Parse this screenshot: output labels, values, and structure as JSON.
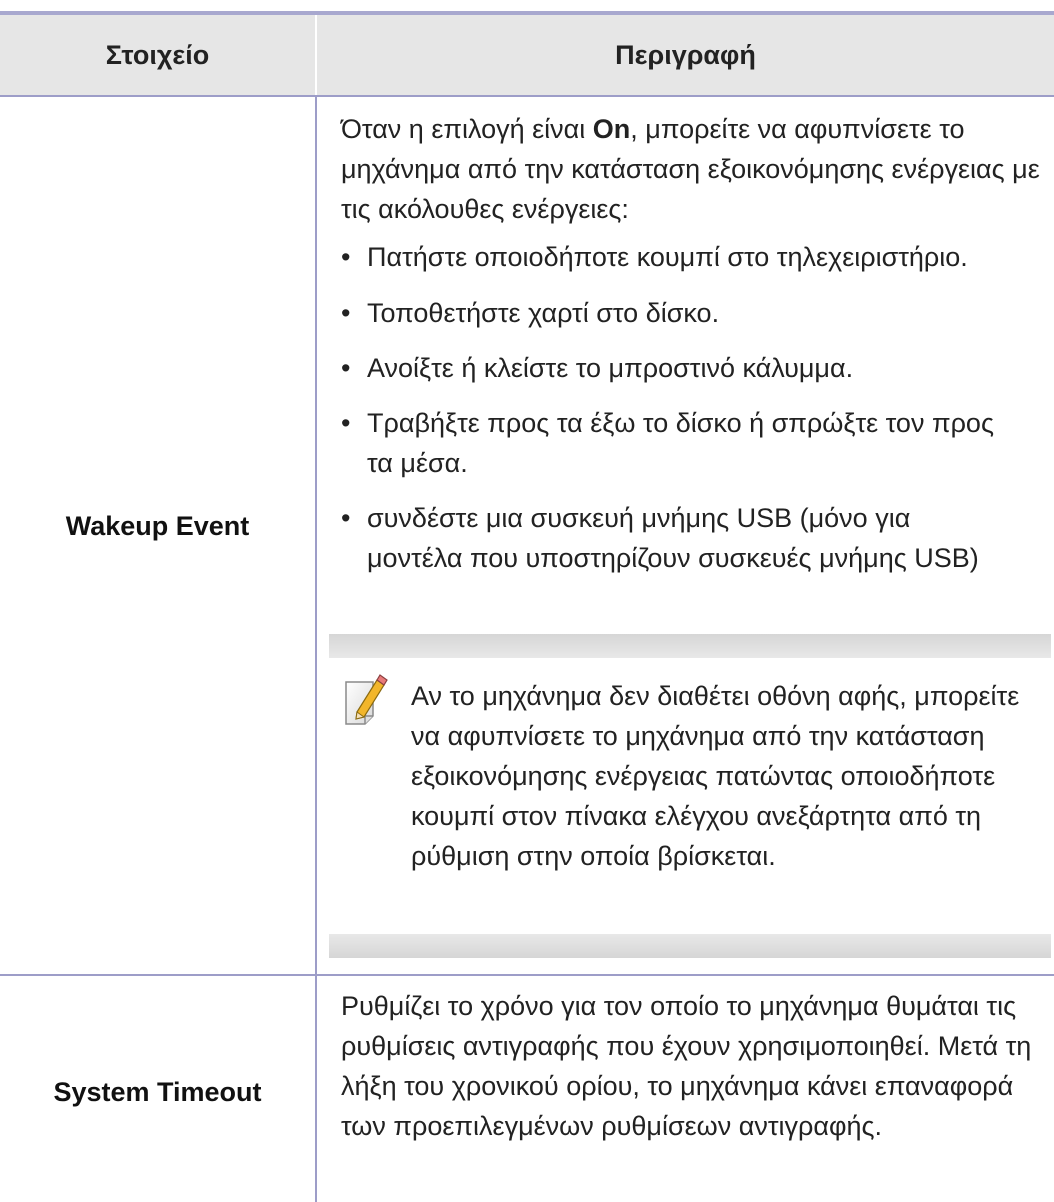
{
  "header": {
    "col1": "Στοιχείο",
    "col2": "Περιγραφή"
  },
  "rows": [
    {
      "label": "Wakeup Event",
      "intro_before": "Όταν η επιλογή είναι ",
      "intro_bold": "On",
      "intro_after": ", μπορείτε να αφυπνίσετε το μηχάνημα από την κατάσταση εξοικονόμησης ενέργειας με τις ακόλουθες ενέργειες:",
      "bullets": [
        "Πατήστε οποιοδήποτε κουμπί στο τηλεχειριστήριο.",
        "Τοποθετήστε χαρτί στο δίσκο.",
        "Ανοίξτε ή κλείστε το μπροστινό κάλυμμα.",
        "Τραβήξτε προς τα έξω το δίσκο ή σπρώξτε τον προς τα μέσα.",
        "συνδέστε μια συσκευή μνήμης USB (μόνο για μοντέλα που υποστηρίζουν συσκευές μνήμης USB)"
      ],
      "note": "Αν το μηχάνημα δεν διαθέτει οθόνη αφής, μπορείτε να αφυπνίσετε το μηχάνημα από την κατάσταση εξοικονόμησης ενέργειας πατώντας οποιοδήποτε κουμπί στον πίνακα ελέγχου ανεξάρτητα από τη ρύθμιση στην οποία βρίσκεται."
    },
    {
      "label": "System Timeout",
      "description": "Ρυθμίζει το χρόνο για τον οποίο το μηχάνημα θυμάται τις ρυθμίσεις αντιγραφής που έχουν χρησιμοποιηθεί. Μετά τη λήξη του χρονικού ορίου, το μηχάνημα κάνει επαναφορά των προεπιλεγμένων ρυθμίσεων αντιγραφής."
    }
  ],
  "icons": {
    "note": "note-pencil-icon"
  },
  "colors": {
    "rule": "#9d9dc8",
    "header_bg": "#e6e6e6",
    "note_band": "#d6d6d6"
  }
}
